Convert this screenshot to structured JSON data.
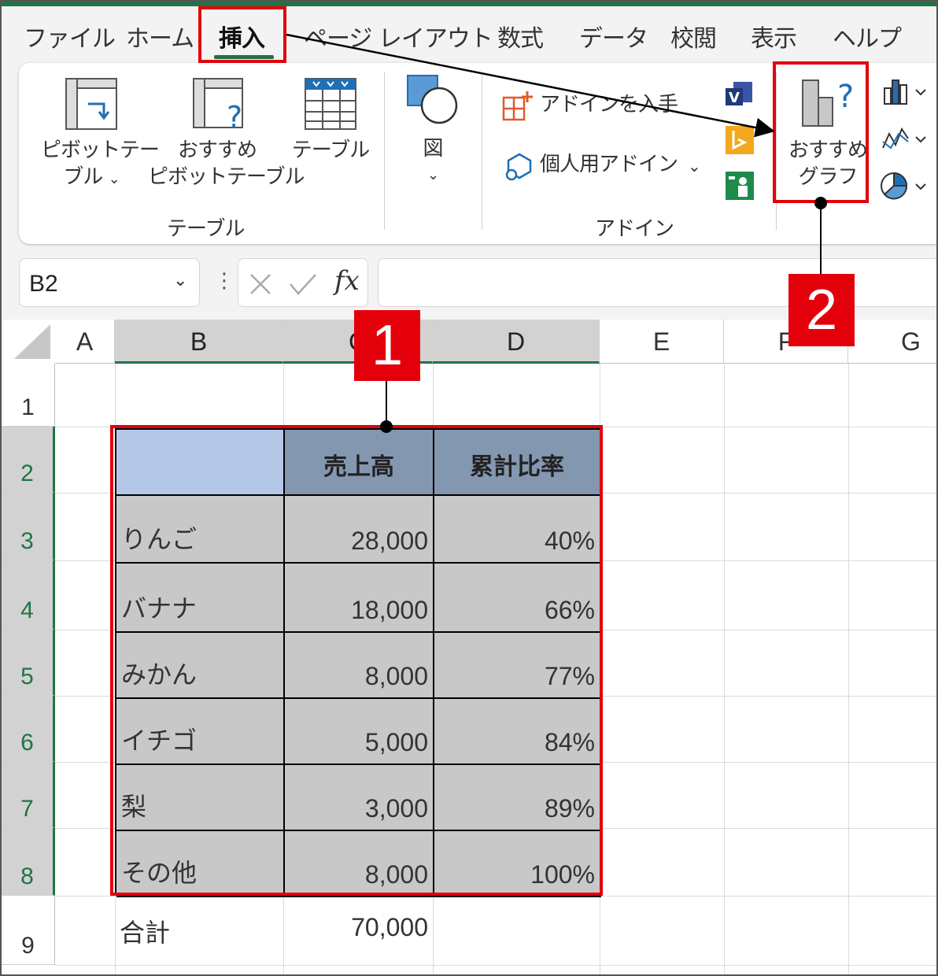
{
  "menu": {
    "tabs": [
      "ファイル",
      "ホーム",
      "挿入",
      "ページ レイアウト",
      "数式",
      "データ",
      "校閲",
      "表示",
      "ヘルプ"
    ],
    "active_tab": "挿入"
  },
  "ribbon": {
    "pivot_table": {
      "line1": "ピボットテー",
      "line2": "ブル"
    },
    "recommended_pivot": {
      "line1": "おすすめ",
      "line2": "ピボットテーブル"
    },
    "table": "テーブル",
    "illustrations": "図",
    "get_addins": "アドインを入手",
    "my_addins": "個人用アドイン",
    "recommended_chart": {
      "line1": "おすすめ",
      "line2": "グラフ"
    },
    "groups": {
      "tables": "テーブル",
      "addins": "アドイン"
    }
  },
  "formula_bar": {
    "name_box": "B2",
    "fx": "fx",
    "formula": ""
  },
  "sheet": {
    "columns": [
      "A",
      "B",
      "C",
      "D",
      "E",
      "F",
      "G"
    ],
    "rows": [
      "1",
      "2",
      "3",
      "4",
      "5",
      "6",
      "7",
      "8",
      "9"
    ],
    "table_header": [
      "",
      "売上高",
      "累計比率"
    ],
    "table_rows": [
      {
        "item": "りんご",
        "sales": "28,000",
        "ratio": "40%"
      },
      {
        "item": "バナナ",
        "sales": "18,000",
        "ratio": "66%"
      },
      {
        "item": "みかん",
        "sales": "8,000",
        "ratio": "77%"
      },
      {
        "item": "イチゴ",
        "sales": "5,000",
        "ratio": "84%"
      },
      {
        "item": "梨",
        "sales": "3,000",
        "ratio": "89%"
      },
      {
        "item": "その他",
        "sales": "8,000",
        "ratio": "100%"
      }
    ],
    "total": {
      "label": "合計",
      "sales": "70,000"
    }
  },
  "annotations": {
    "step1": "1",
    "step2": "2"
  },
  "colors": {
    "accent_green": "#217346",
    "highlight_red": "#e3000b",
    "header_fill": "#8497b0",
    "corner_fill": "#b4c7e7",
    "selection_fill": "#c8c8c8"
  }
}
